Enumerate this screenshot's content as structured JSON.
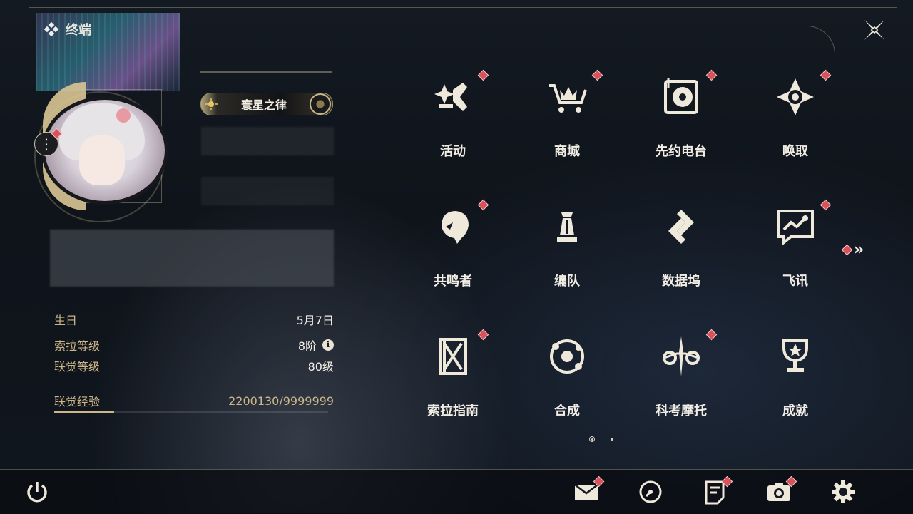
{
  "header": {
    "title": "终端"
  },
  "profile": {
    "badge_title": "寰星之律",
    "info": [
      {
        "label": "生日",
        "value": "5月7日"
      },
      {
        "label": "索拉等级",
        "value": "8阶",
        "icon": "info-icon"
      },
      {
        "label": "联觉等级",
        "value": "80级"
      }
    ],
    "experience": {
      "label": "联觉经验",
      "value": "2200130/9999999",
      "progress": 0.22
    }
  },
  "menu": {
    "items": [
      {
        "label": "活动",
        "icon": "activity-sparkle-icon",
        "badge": true
      },
      {
        "label": "商城",
        "icon": "shop-cart-icon",
        "badge": true
      },
      {
        "label": "先约电台",
        "icon": "radio-record-icon",
        "badge": true
      },
      {
        "label": "唤取",
        "icon": "summon-compass-icon",
        "badge": true
      },
      {
        "label": "共鸣者",
        "icon": "resonator-head-icon",
        "badge": true
      },
      {
        "label": "编队",
        "icon": "team-chess-icon",
        "badge": false
      },
      {
        "label": "数据坞",
        "icon": "data-dock-icon",
        "badge": false
      },
      {
        "label": "飞讯",
        "icon": "message-chat-icon",
        "badge": true
      },
      {
        "label": "索拉指南",
        "icon": "guide-book-icon",
        "badge": true
      },
      {
        "label": "合成",
        "icon": "synthesis-orbit-icon",
        "badge": false
      },
      {
        "label": "科考摩托",
        "icon": "motorbike-icon",
        "badge": true
      },
      {
        "label": "成就",
        "icon": "trophy-icon",
        "badge": false
      }
    ],
    "next_page_icon": "double-chevron-right-icon",
    "pages": 2,
    "current_page": 1
  },
  "bottom_bar": {
    "left": [
      {
        "icon": "power-icon"
      }
    ],
    "right": [
      {
        "icon": "mail-icon",
        "badge": true
      },
      {
        "icon": "clock-icon",
        "badge": false
      },
      {
        "icon": "notice-icon",
        "badge": true
      },
      {
        "icon": "camera-icon",
        "badge": true
      },
      {
        "icon": "settings-gear-icon",
        "badge": false
      }
    ]
  },
  "colors": {
    "accent_gold": "#cdb789",
    "badge_red": "#d8525a",
    "text": "#f1ede4"
  }
}
